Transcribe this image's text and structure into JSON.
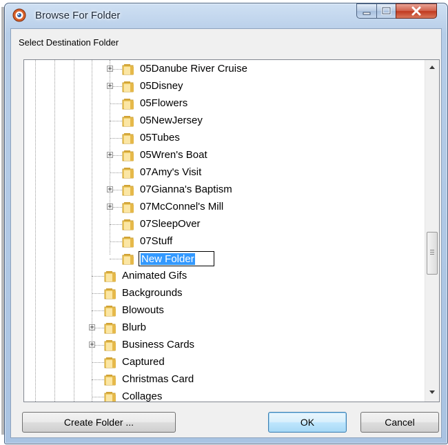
{
  "window": {
    "title": "Browse For Folder",
    "prompt": "Select Destination Folder"
  },
  "tree": {
    "items": [
      {
        "label": "05Danube River Cruise",
        "expandable": true,
        "indent": 2
      },
      {
        "label": "05Disney",
        "expandable": true,
        "indent": 2
      },
      {
        "label": "05Flowers",
        "expandable": false,
        "indent": 2
      },
      {
        "label": "05NewJersey",
        "expandable": false,
        "indent": 2
      },
      {
        "label": "05Tubes",
        "expandable": false,
        "indent": 2
      },
      {
        "label": "05Wren's Boat",
        "expandable": true,
        "indent": 2
      },
      {
        "label": "07Amy's Visit",
        "expandable": false,
        "indent": 2
      },
      {
        "label": "07Gianna's Baptism",
        "expandable": true,
        "indent": 2
      },
      {
        "label": "07McConnel's Mill",
        "expandable": true,
        "indent": 2
      },
      {
        "label": "07SleepOver",
        "expandable": false,
        "indent": 2
      },
      {
        "label": "07Stuff",
        "expandable": false,
        "indent": 2
      },
      {
        "label": "New Folder",
        "expandable": false,
        "indent": 2,
        "editing": true
      },
      {
        "label": "Animated Gifs",
        "expandable": false,
        "indent": 1
      },
      {
        "label": "Backgrounds",
        "expandable": false,
        "indent": 1
      },
      {
        "label": "Blowouts",
        "expandable": false,
        "indent": 1
      },
      {
        "label": "Blurb",
        "expandable": true,
        "indent": 1
      },
      {
        "label": "Business Cards",
        "expandable": true,
        "indent": 1
      },
      {
        "label": "Captured",
        "expandable": false,
        "indent": 1
      },
      {
        "label": "Christmas Card",
        "expandable": false,
        "indent": 1
      },
      {
        "label": "Collages",
        "expandable": false,
        "indent": 1
      }
    ]
  },
  "buttons": {
    "create_folder": "Create Folder ...",
    "ok": "OK",
    "cancel": "Cancel"
  },
  "icons": {
    "app": "app-icon",
    "folder": "folder-icon",
    "expand": "plus-expander-icon",
    "minimize": "minimize-icon",
    "maximize": "maximize-icon",
    "close": "close-icon",
    "scroll_up": "scroll-up-arrow-icon",
    "scroll_down": "scroll-down-arrow-icon"
  },
  "colors": {
    "selection": "#3399ff",
    "folder": "#e8c15a",
    "close_button": "#c73d22"
  }
}
